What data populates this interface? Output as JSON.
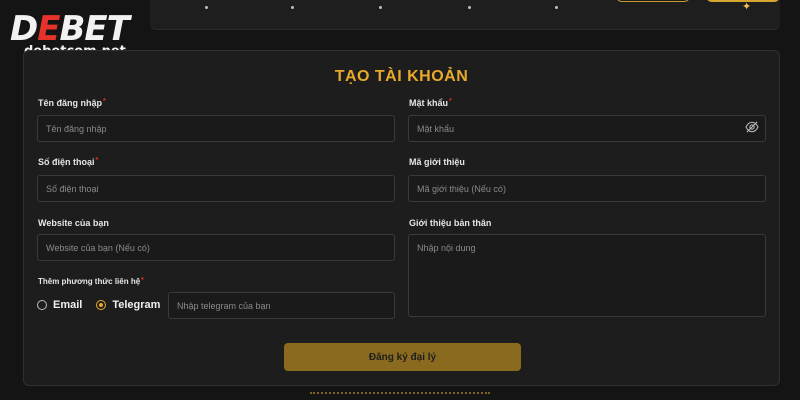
{
  "brand": {
    "logo_prefix": "D",
    "logo_accent": "E",
    "logo_suffix": "BET",
    "domain": "debetcom.net"
  },
  "form": {
    "title": "TẠO TÀI KHOẢN",
    "required_mark": "*",
    "username": {
      "label": "Tên đăng nhập",
      "placeholder": "Tên đăng nhập"
    },
    "password": {
      "label": "Mật khẩu",
      "placeholder": "Mật khẩu"
    },
    "phone": {
      "label": "Số điện thoại",
      "placeholder": "Số điện thoại"
    },
    "referral": {
      "label": "Mã giới thiệu",
      "placeholder": "Mã giới thiệu (Nếu có)"
    },
    "website": {
      "label": "Website của bạn",
      "placeholder": "Website của bạn (Nếu có)"
    },
    "bio": {
      "label": "Giới thiệu bản thân",
      "placeholder": "Nhập nội dung"
    },
    "contact": {
      "label": "Thêm phương thức liên hệ",
      "options": [
        "Email",
        "Telegram"
      ],
      "selected": "Telegram",
      "placeholder": "Nhập telegram của bạn"
    },
    "submit_label": "Đăng ký đại lý"
  },
  "icons": {
    "password_toggle": "eye-off-icon",
    "sparkle": "sparkle-icon"
  },
  "colors": {
    "accent": "#e9a92b",
    "brand_red": "#e5322b",
    "button": "#8a6a1f",
    "background": "#141414",
    "card": "#1d1d1d"
  }
}
